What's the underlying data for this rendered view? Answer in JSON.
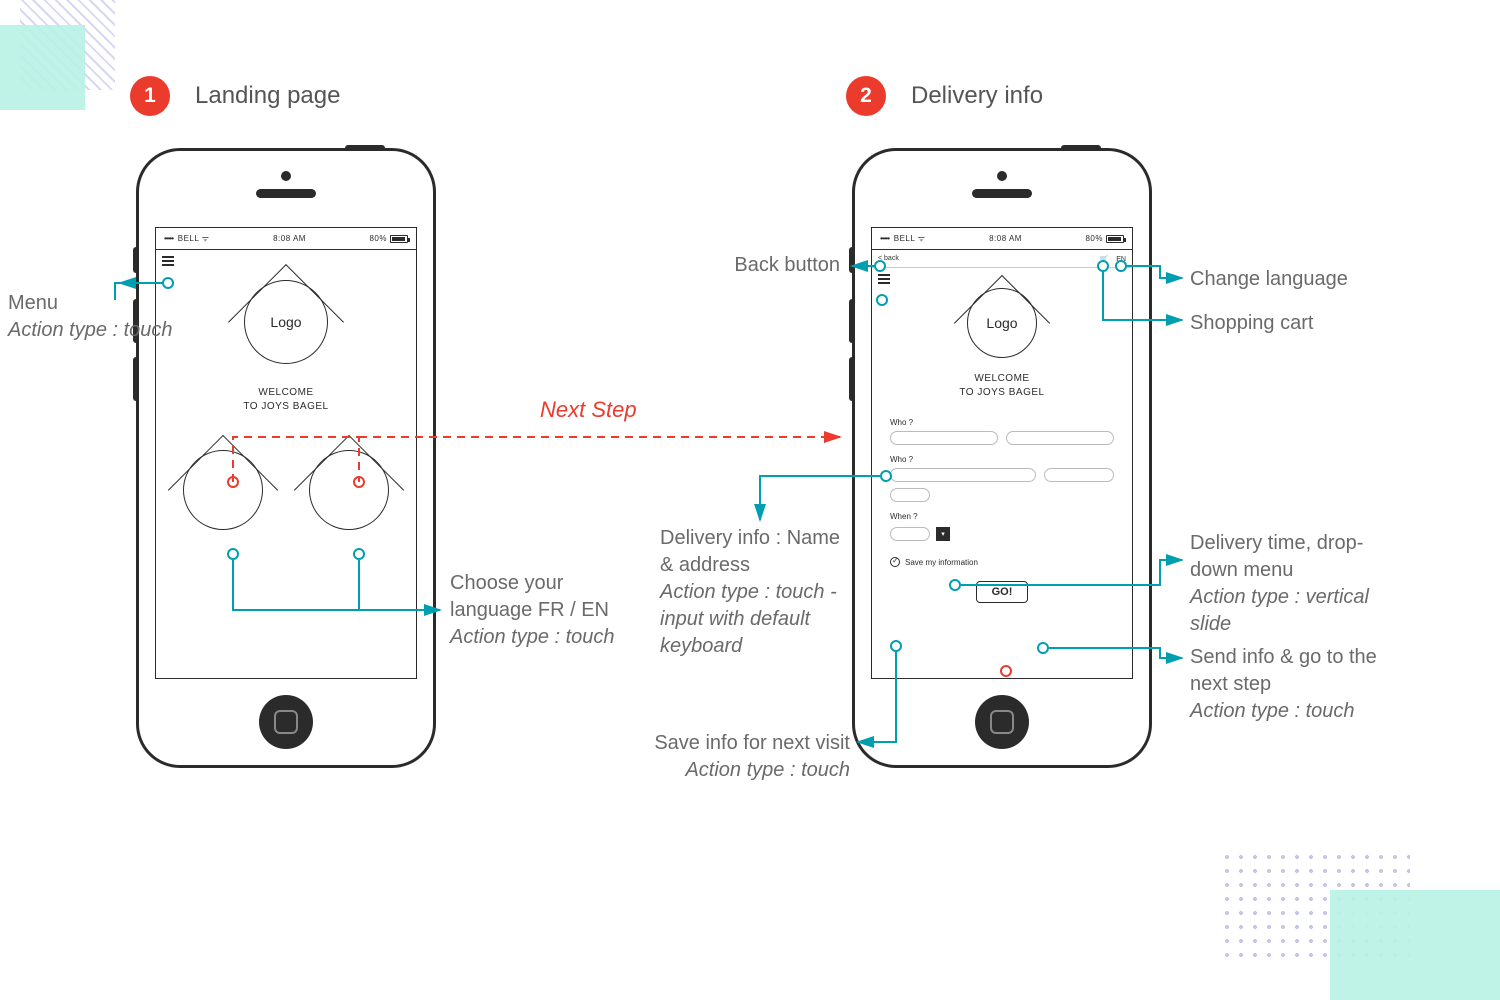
{
  "steps": [
    {
      "num": "1",
      "title": "Landing page"
    },
    {
      "num": "2",
      "title": "Delivery info"
    }
  ],
  "statusbar": {
    "carrier": "BELL",
    "time": "8:08 AM",
    "battery": "80%"
  },
  "nav": {
    "back": "< back",
    "lang": "EN"
  },
  "logo": "Logo",
  "welcome_l1": "WELCOME",
  "welcome_l2": "TO JOYS BAGEL",
  "form": {
    "who": "Who ?",
    "who2": "Who ?",
    "when": "When ?",
    "save": "Save my information",
    "go": "GO!"
  },
  "next": "Next Step",
  "ann": {
    "menu_t": "Menu",
    "menu_s": "Action type : touch",
    "lang_t": "Choose your language FR / EN",
    "lang_s": "Action type : touch",
    "back_t": "Back button",
    "chlang_t": "Change language",
    "cart_t": "Shopping cart",
    "deliv_t": "Delivery info : Name & address",
    "deliv_s": "Action type : touch - input with default keyboard",
    "time_t": "Delivery time, drop-down menu",
    "time_s": "Action type : vertical slide",
    "send_t": "Send info & go to the next step",
    "send_s": "Action type : touch",
    "save_t": "Save info for next visit",
    "save_s": "Action type : touch"
  }
}
